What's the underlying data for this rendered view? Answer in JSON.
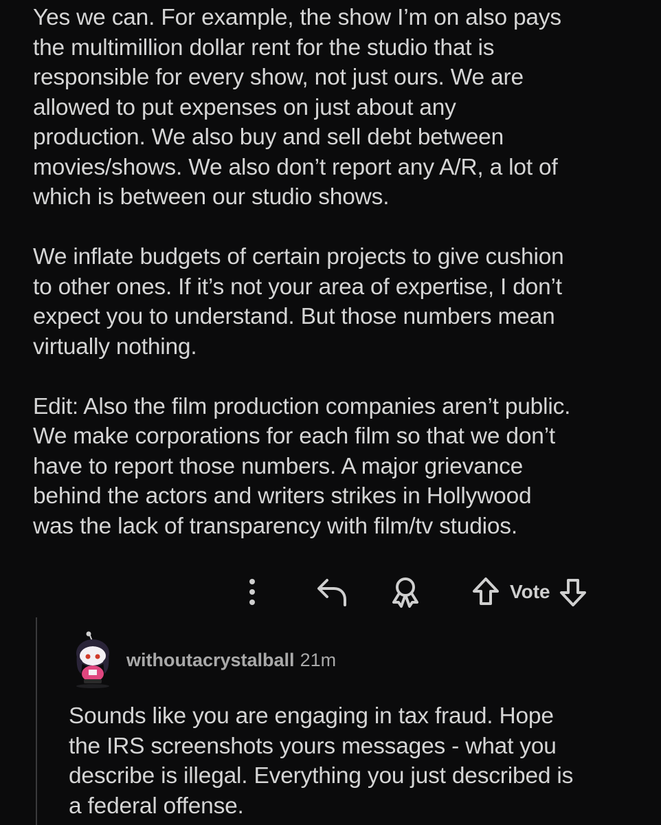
{
  "comment": {
    "paragraphs": [
      [
        "Yes we can. For example, the show I’m on also pays",
        "the multimillion dollar rent for the studio that is",
        "responsible for every show, not just ours. We are",
        "allowed to put expenses on just about any",
        "production. We also buy and sell debt between",
        "movies/shows. We also don’t report any A/R, a lot of",
        "which is between our studio shows."
      ],
      [
        "We inflate budgets of certain projects to give cushion",
        "to other ones. If it’s not your area of expertise, I don’t",
        "expect you to understand. But those numbers mean",
        "virtually nothing."
      ],
      [
        "Edit: Also the film production companies aren’t public.",
        "We make corporations for each film so that we don’t",
        "have to report those numbers. A major grievance",
        "behind the actors and writers strikes in Hollywood",
        "was the lack of transparency with film/tv studios."
      ]
    ]
  },
  "actions": {
    "more_icon": "more-vertical-icon",
    "reply_icon": "reply-arrow-icon",
    "award_icon": "award-icon",
    "upvote_icon": "upvote-arrow-icon",
    "vote_label": "Vote",
    "downvote_icon": "downvote-arrow-icon"
  },
  "reply": {
    "username": "withoutacrystalball",
    "time": "21m",
    "lines": [
      "Sounds like you are engaging in tax fraud. Hope",
      "the IRS screenshots yours messages - what you",
      "describe is illegal. Everything you just described is",
      "a federal offense."
    ]
  },
  "colors": {
    "background": "#0b0b0c",
    "text": "#d5d5d5",
    "muted": "#a9a9a9",
    "thread_line": "#3a3a3c",
    "avatar_shirt": "#e0467f"
  }
}
